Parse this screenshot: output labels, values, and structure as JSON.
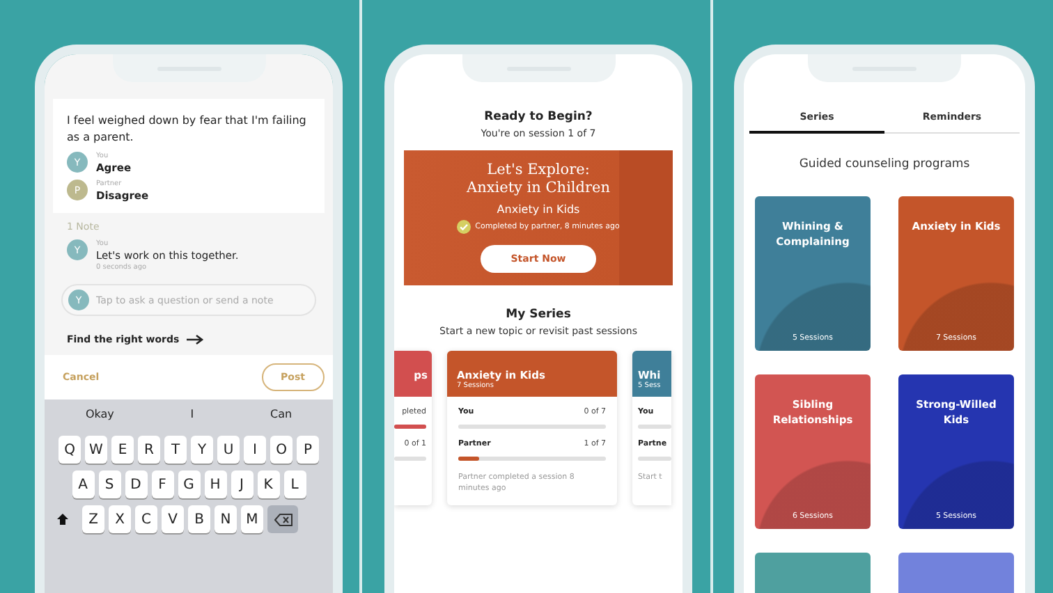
{
  "screens": [
    {
      "kind": "discussion",
      "statement": "I feel weighed down by fear that I'm failing as a parent.",
      "responses": [
        {
          "avatar": "Y",
          "role": "You",
          "answer": "Agree",
          "color": "#86b9bd"
        },
        {
          "avatar": "P",
          "role": "Partner",
          "answer": "Disagree",
          "color": "#bdb98e"
        }
      ],
      "note_count": "1 Note",
      "notes": [
        {
          "avatar": "Y",
          "role": "You",
          "text": "Let's work on this together.",
          "time": "0 seconds ago",
          "color": "#86b9bd"
        }
      ],
      "composer": {
        "avatar": "Y",
        "color": "#86b9bd",
        "placeholder": "Tap to ask a question or send a note"
      },
      "link": "Find the right words",
      "actions": {
        "cancel": "Cancel",
        "post": "Post"
      },
      "keyboard": {
        "suggestions": [
          "Okay",
          "I",
          "Can"
        ],
        "rows": [
          [
            "Q",
            "W",
            "E",
            "R",
            "T",
            "Y",
            "U",
            "I",
            "O",
            "P"
          ],
          [
            "A",
            "S",
            "D",
            "F",
            "G",
            "H",
            "J",
            "K",
            "L"
          ],
          [
            "Z",
            "X",
            "C",
            "V",
            "B",
            "N",
            "M"
          ]
        ]
      }
    },
    {
      "kind": "home",
      "heading": "Ready to Begin?",
      "subheading": "You're on session 1 of 7",
      "hero": {
        "title": "Let's Explore: Anxiety in Children",
        "series": "Anxiety in Kids",
        "status": "Completed by partner, 8 minutes ago",
        "button": "Start Now"
      },
      "section_title": "My Series",
      "section_subtitle": "Start a new topic or revisit past sessions",
      "cards": [
        {
          "kind": "partial-left",
          "title": "ps",
          "color": "#d24f4f",
          "rows": [
            {
              "reading": "pleted",
              "level": 1
            },
            {
              "reading": "0 of 1",
              "level": 0
            }
          ]
        },
        {
          "kind": "full",
          "title": "Anxiety in Kids",
          "sessions": "7 Sessions",
          "color": "#c4552a",
          "rows": [
            {
              "label": "You",
              "reading": "0 of 7",
              "level": 0
            },
            {
              "label": "Partner",
              "reading": "1 of 7",
              "level": 0.14
            }
          ],
          "footer": "Partner completed a session 8 minutes ago"
        },
        {
          "kind": "partial-right",
          "title": "Whi",
          "sessions": "5 Sess",
          "color": "#3f7f99",
          "rows": [
            {
              "label": "You",
              "level": 0
            },
            {
              "label": "Partne",
              "level": 0
            }
          ],
          "footer": "Start t"
        }
      ]
    },
    {
      "kind": "series",
      "tabs": [
        {
          "label": "Series",
          "selected": true
        },
        {
          "label": "Reminders",
          "selected": false
        }
      ],
      "heading": "Guided counseling programs",
      "tiles": [
        {
          "title": "Whining & Complaining",
          "sessions": "5 Sessions",
          "color": "#3f7f99"
        },
        {
          "title": "Anxiety in Kids",
          "sessions": "7 Sessions",
          "color": "#c4552a"
        },
        {
          "title": "Sibling Relationships",
          "sessions": "6 Sessions",
          "color": "#d25552"
        },
        {
          "title": "Strong-Willed Kids",
          "sessions": "5 Sessions",
          "color": "#2535b0"
        },
        {
          "color": "#4fa09f"
        },
        {
          "color": "#7282dc"
        }
      ]
    }
  ]
}
